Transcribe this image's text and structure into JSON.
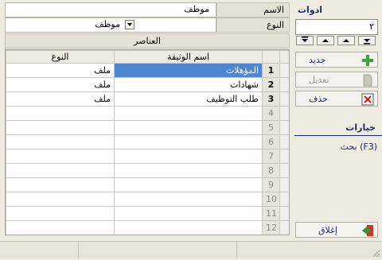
{
  "form": {
    "name_label": "الاسم",
    "name_value": "موظف",
    "type_label": "النوع",
    "type_value": "موظف"
  },
  "elements_section": {
    "title": "العناصر",
    "columns": {
      "row": "",
      "name": "اسم الوثيقة",
      "type": "النوع"
    },
    "rows": [
      {
        "num": "1",
        "name": "المؤهلات",
        "type": "ملف"
      },
      {
        "num": "2",
        "name": "شهادات",
        "type": "ملف"
      },
      {
        "num": "3",
        "name": "طلب التوظيف",
        "type": "ملف"
      },
      {
        "num": "4",
        "name": "",
        "type": ""
      },
      {
        "num": "5",
        "name": "",
        "type": ""
      },
      {
        "num": "6",
        "name": "",
        "type": ""
      },
      {
        "num": "7",
        "name": "",
        "type": ""
      },
      {
        "num": "8",
        "name": "",
        "type": ""
      },
      {
        "num": "9",
        "name": "",
        "type": ""
      },
      {
        "num": "10",
        "name": "",
        "type": ""
      },
      {
        "num": "11",
        "name": "",
        "type": ""
      },
      {
        "num": "12",
        "name": "",
        "type": ""
      }
    ]
  },
  "tools": {
    "title": "ادوات",
    "record_number": "٢",
    "nav_icons": [
      "last-record-icon",
      "next-record-icon",
      "previous-record-icon",
      "first-record-icon"
    ]
  },
  "actions": {
    "new_label": "جديد",
    "edit_label": "تعديل",
    "delete_label": "حذف",
    "close_label": "إغلاق"
  },
  "options": {
    "title": "خيارات",
    "search_label": "بحث (F3)"
  },
  "colors": {
    "selection": "#4f86d2",
    "accent_text": "#1e2a73"
  }
}
